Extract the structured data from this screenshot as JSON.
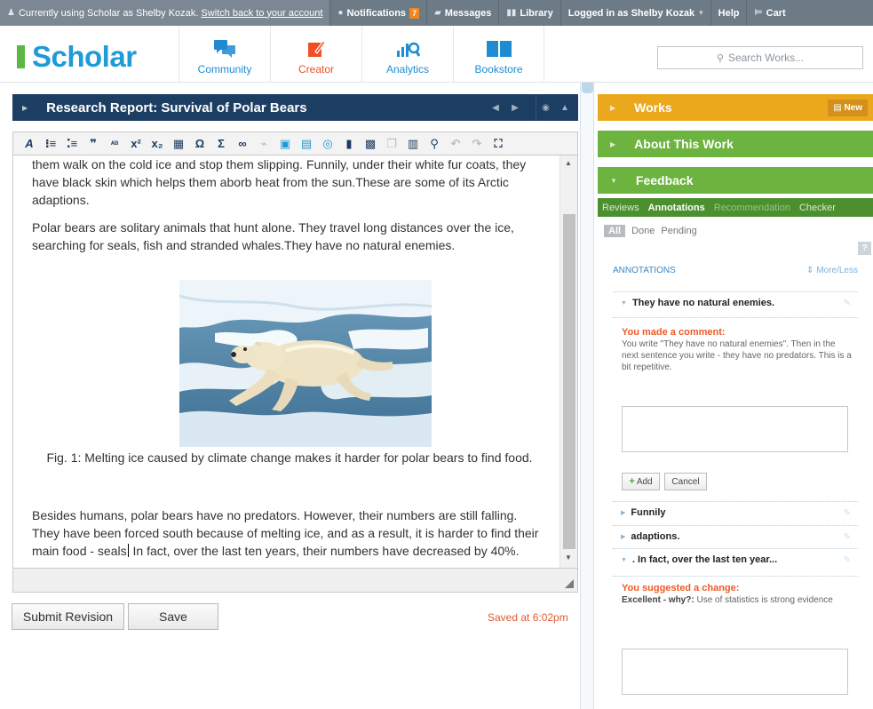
{
  "topbar": {
    "user_notice_prefix": "Currently using Scholar as Shelby Kozak.",
    "switch_back_link": "Switch back to your account",
    "notifications_label": "Notifications",
    "notifications_count": "7",
    "messages_label": "Messages",
    "library_label": "Library",
    "logged_in_label": "Logged in as Shelby Kozak",
    "help_label": "Help",
    "cart_label": "Cart"
  },
  "nav": {
    "logo_text": "Scholar",
    "community_label": "Community",
    "creator_label": "Creator",
    "analytics_label": "Analytics",
    "bookstore_label": "Bookstore",
    "search_placeholder": "Search Works..."
  },
  "editor": {
    "title": "Research Report: Survival of Polar Bears",
    "para1": "them walk on the cold ice and stop them slipping. Funnily, under their white fur coats, they have black skin which helps them aborb heat from the sun.These are some of its Arctic adaptions.",
    "para2": "Polar bears are solitary animals that hunt alone. They travel long distances over the ice, searching for seals, fish and stranded whales.They have no natural enemies.",
    "caption": "Fig. 1: Melting ice caused by climate change makes it harder for polar bears to find food.",
    "para3_a": "Besides humans, polar bears have no predators. However, their numbers are still falling. They have been forced south because of melting ice, and as a result, it is harder to find their main food - seals",
    "para3_b": " In fact, over the last ten years, their numbers have decreased by 40%.",
    "submit_label": "Submit Revision",
    "save_label": "Save",
    "saved_status": "Saved at 6:02pm"
  },
  "panels": {
    "works_label": "Works",
    "new_label": "New",
    "about_label": "About This Work",
    "feedback_label": "Feedback"
  },
  "feedback": {
    "tabs": [
      "Reviews",
      "Annotations",
      "Recommendation",
      "Checker"
    ],
    "filters": [
      "All",
      "Done",
      "Pending"
    ],
    "help_glyph": "?",
    "annotations_heading": "ANNOTATIONS",
    "more_less": "More/Less",
    "item1_title": "They have no natural enemies.",
    "item1_comment_heading": "You made a comment:",
    "item1_comment_body": "You write \"They have no natural enemies\". Then in the next sentence you write - they have no predators. This is a bit repetitive.",
    "add_label": "Add",
    "cancel_label": "Cancel",
    "item2_title": "Funnily",
    "item3_title": "adaptions.",
    "item4_title": ". In fact, over the last ten year...",
    "item4_comment_heading": "You suggested a change:",
    "item4_comment_bold": "Excellent - why?:",
    "item4_comment_body": " Use of statistics is strong evidence"
  },
  "colors": {
    "editor_header": "#1d3e63",
    "works_panel": "#eca81d",
    "feedback_panel": "#6cb33f",
    "accent_orange": "#ef5a26",
    "brand_blue": "#1f9bd8"
  }
}
